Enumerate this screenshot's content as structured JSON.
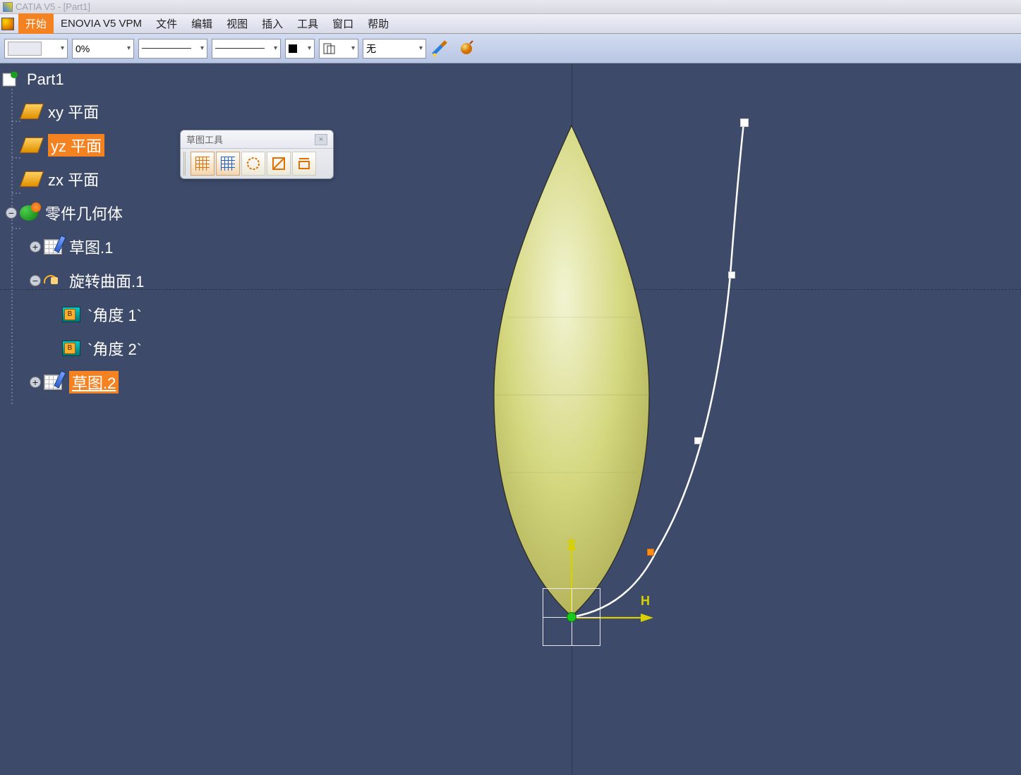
{
  "titlebar": {
    "text": "CATIA V5 - [Part1]"
  },
  "menu": {
    "items": [
      "开始",
      "ENOVIA V5 VPM",
      "文件",
      "编辑",
      "视图",
      "插入",
      "工具",
      "窗口",
      "帮助"
    ],
    "highlight_index": 0
  },
  "toolbar": {
    "opacity": "0%",
    "render_combo": "无"
  },
  "tree": {
    "root": "Part1",
    "planes": [
      "xy 平面",
      "yz 平面",
      "zx 平面"
    ],
    "selected_plane_index": 1,
    "body": "零件几何体",
    "sketch1": "草图.1",
    "revolve": "旋转曲面.1",
    "angle1": "`角度 1`",
    "angle2": "`角度 2`",
    "sketch2": "草图.2"
  },
  "sketch_tools": {
    "title": "草图工具"
  },
  "viewport": {
    "axis_label_h": "H"
  }
}
